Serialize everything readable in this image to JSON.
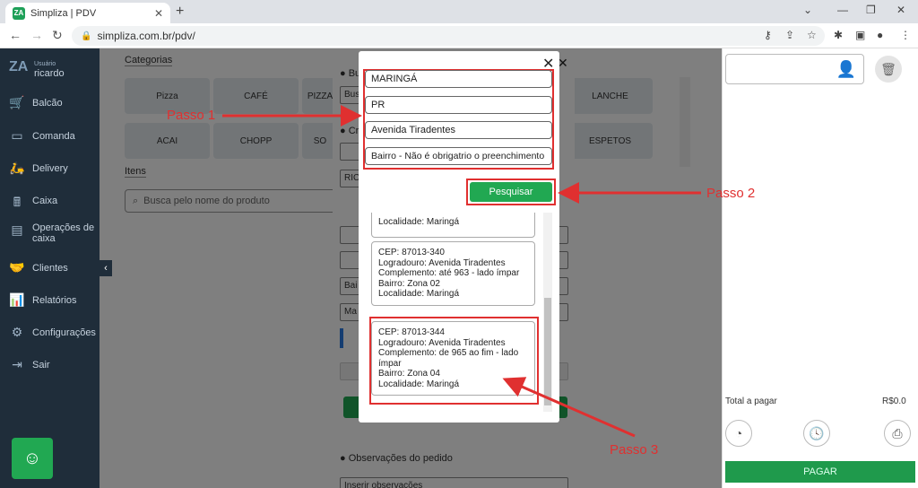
{
  "browser": {
    "tab_title": "Simpliza | PDV",
    "favicon_text": "ZA",
    "url": "simpliza.com.br/pdv/"
  },
  "sidebar": {
    "logo": "ZA",
    "user_label": "Usuário",
    "user_name": "ricardo",
    "items": [
      {
        "label": "Balcão",
        "icon": "cashier-icon"
      },
      {
        "label": "Comanda",
        "icon": "card-icon"
      },
      {
        "label": "Delivery",
        "icon": "scooter-icon"
      },
      {
        "label": "Caixa",
        "icon": "register-icon"
      },
      {
        "label": "Operações de caixa",
        "icon": "operations-icon"
      },
      {
        "label": "Clientes",
        "icon": "handshake-icon"
      },
      {
        "label": "Relatórios",
        "icon": "report-icon"
      },
      {
        "label": "Configurações",
        "icon": "gears-icon"
      },
      {
        "label": "Sair",
        "icon": "exit-icon"
      }
    ]
  },
  "main": {
    "categories_label": "Categorias",
    "categories": [
      "Pizza",
      "CAFÉ",
      "PIZZA",
      "LANCHE",
      "ACAI",
      "CHOPP",
      "SO",
      "ESPETOS"
    ],
    "items_label": "Itens",
    "search_placeholder": "Busca pelo nome do produto"
  },
  "delivery_panel": {
    "bullet1": "Bu",
    "bullet2": "Cr",
    "field_bu": "Bus",
    "field_ric": "RIC",
    "field_bai": "Bai",
    "field_ma": "Ma",
    "obs_label": "Observações do pedido",
    "obs_placeholder": "Inserir observações"
  },
  "modal": {
    "city": "MARINGÁ",
    "state": "PR",
    "street": "Avenida Tiradentes",
    "neighborhood_placeholder": "Bairro - Não é obrigatrio o preenchimento",
    "search_label": "Pesquisar",
    "results": [
      {
        "lines": [
          "Localidade: Maringá"
        ]
      },
      {
        "lines": [
          "CEP: 87013-340",
          "Logradouro: Avenida Tiradentes",
          "Complemento: até 963 - lado ímpar",
          "Bairro: Zona 02",
          "Localidade: Maringá"
        ]
      },
      {
        "lines": [
          "CEP: 87013-344",
          "Logradouro: Avenida Tiradentes",
          "Complemento: de 965 ao fim - lado ímpar",
          "Bairro: Zona 04",
          "Localidade: Maringá"
        ]
      }
    ]
  },
  "cart": {
    "total_label": "Total a pagar",
    "total_value": "R$0.0",
    "pay_label": "PAGAR"
  },
  "annotations": {
    "step1": "Passo 1",
    "step2": "Passo 2",
    "step3": "Passo 3",
    "color": "#e03030"
  }
}
